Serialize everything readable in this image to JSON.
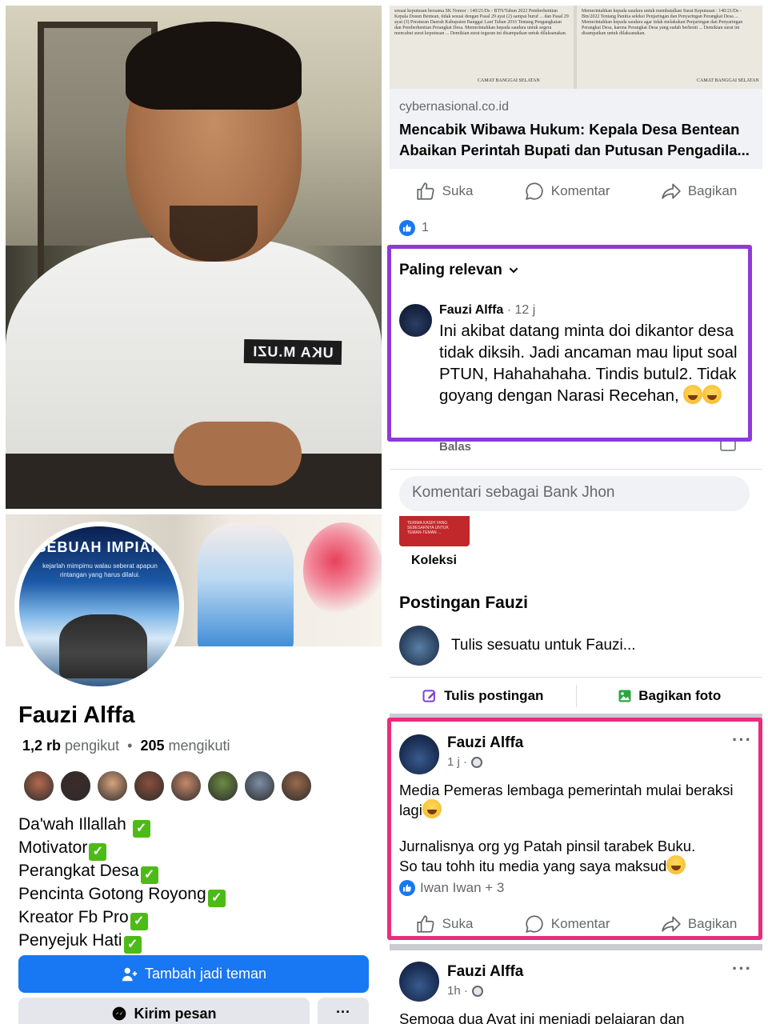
{
  "left": {
    "photo_nametag": "UKA M.UZI",
    "profile": {
      "name": "Fauzi Alffa",
      "followers_count": "1,2 rb",
      "followers_label": "pengikut",
      "following_count": "205",
      "following_label": "mengikuti",
      "avatar_banner": "SEBUAH IMPIAN",
      "avatar_subtitle": "kejarlah mimpimu walau seberat apapun rintangan yang harus dilalui."
    },
    "friend_colors": [
      "#b4694e",
      "#3d2b28",
      "#d9a37d",
      "#8a4f3c",
      "#c8896a",
      "#6e8b42",
      "#7d8ea6",
      "#9a6a4c"
    ],
    "bio": [
      "Da'wah Illallah ",
      "Motivator",
      "Perangkat Desa",
      "Pencinta Gotong Royong",
      "Kreator Fb Pro",
      "Penyejuk Hati"
    ],
    "buttons": {
      "add_friend": "Tambah jadi teman",
      "message": "Kirim pesan",
      "more": "···"
    }
  },
  "right": {
    "shared_doc": {
      "page1_text": "sesuai keputusan bersama SK Nomor : 140/21/Ds - BTN/Tahun 2022 Pemberhentian Kepala Dusun Bentean, tidak sesuai dengan Pasal 29 ayat (2) sampai huruf ... dan Pasal 29 ayat (3) Peraturan Daerah Kabupaten Banggai Laut Tahun 2016 Tentang Pengangkatan dan Pemberhentian Perangkat Desa. Memerintahkan kepada saudara untuk segera mencabut surat keputusan ... Demikian surat teguran ini disampaikan untuk dilaksanakan.",
      "page1_sign": "CAMAT BANGGAI SELATAN",
      "page2_text": "Memerintahkan kepada saudara untuk membatalkan Surat Keputusan : 140/21/Ds - Btn/2022 Tentang Panitia seleksi Penjaringan dan Penyaringan Perangkat Desa ... Memerintahkan kepada saudara agar tidak melakukan Penjaringan dan Penyaringan Perangkat Desa, karena Perangkat Desa yang sudah berhenti ... Demikian surat ini disampaikan untuk dilaksanakan.",
      "page2_sign": "CAMAT BANGGAI SELATAN"
    },
    "link": {
      "domain": "cybernasional.co.id",
      "title": "Mencabik Wibawa Hukum: Kepala Desa Bentean",
      "title2": "Abaikan Perintah Bupati dan Putusan Pengadila..."
    },
    "actions": {
      "like": "Suka",
      "comment": "Komentar",
      "share": "Bagikan"
    },
    "reaction_count": "1",
    "comments": {
      "sort_label": "Paling relevan",
      "author": "Fauzi Alffa",
      "time": "· 12 j",
      "text": "Ini akibat datang minta doi dikantor desa tidak diksih. Jadi ancaman mau liput soal PTUN, Hahahahaha. Tindis butul2. Tidak goyang dengan Narasi Recehan, ",
      "reply": "Balas",
      "input_placeholder": "Komentari sebagai Bank Jhon"
    },
    "koleksi": {
      "label": "Koleksi",
      "thumb_text": "TERIMA KASIH YANG SEBESARNYA UNTUK TEMAN-TEMAN ..."
    },
    "postingan": {
      "title": "Postingan Fauzi",
      "prompt": "Tulis sesuatu untuk Fauzi...",
      "write_post": "Tulis postingan",
      "share_photo": "Bagikan foto"
    },
    "post1": {
      "author": "Fauzi Alffa",
      "time": "1 j ·",
      "line1": "Media Pemeras lembaga pemerintah mulai beraksi",
      "line2": "lagi",
      "line3": "Jurnalisnya org yg Patah pinsil tarabek Buku.",
      "line4": "So tau tohh itu media yang saya maksud",
      "likes": "Iwan Iwan + 3",
      "more": "···"
    },
    "post2": {
      "author": "Fauzi Alffa",
      "time": "1h ·",
      "text": "Semoga dua Ayat ini menjadi pelajaran dan",
      "more": "···"
    }
  },
  "colors": {
    "primary": "#1877f2",
    "purple_highlight": "#8e3ad8",
    "pink_highlight": "#e92c7d",
    "secondary_text": "#65676b"
  }
}
